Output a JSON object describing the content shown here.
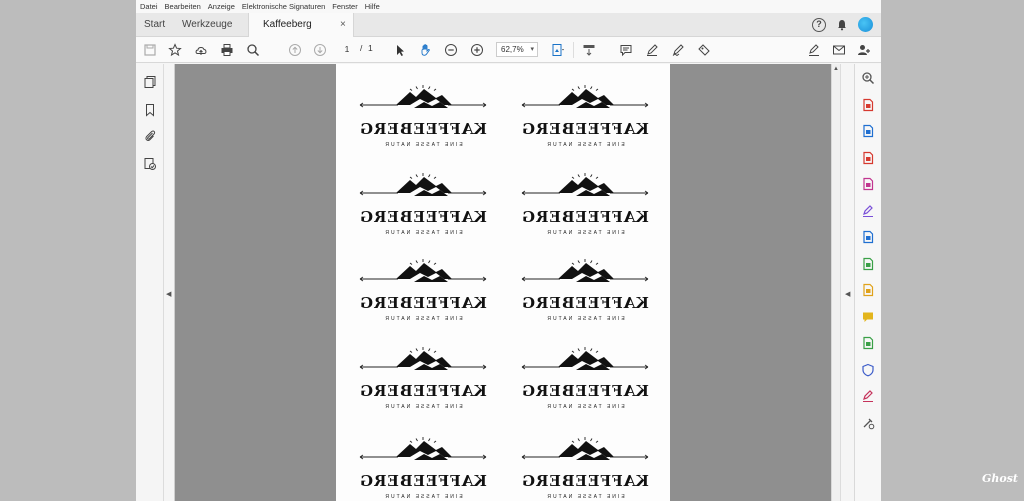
{
  "menu": [
    "Datei",
    "Bearbeiten",
    "Anzeige",
    "Elektronische Signaturen",
    "Fenster",
    "Hilfe"
  ],
  "tabs": {
    "start": "Start",
    "tools": "Werkzeuge",
    "document": "Kaffeeberg Tasse.pdf",
    "close": "×"
  },
  "toolbar": {
    "page_current": "1",
    "page_sep": "/",
    "page_total": "1",
    "zoom": "62,7%"
  },
  "label": {
    "brand": "KAFFEEBERG",
    "tagline": "EINE TASSE NATUR"
  },
  "watermark": "Ghost",
  "colors": {
    "accent_blue": "#1a8fd8",
    "viewport_bg": "#8f8f8f",
    "page_bg": "#fdfdfd"
  },
  "right_tools": [
    "zoom-icon",
    "export-pdf-icon",
    "edit-pdf-icon",
    "organize-pages-icon",
    "compress-pdf-icon",
    "fill-sign-icon",
    "create-pdf-icon",
    "combine-files-icon",
    "export-icon",
    "comment-icon",
    "print-production-icon",
    "protect-icon",
    "request-signature-icon",
    "more-tools-icon"
  ]
}
